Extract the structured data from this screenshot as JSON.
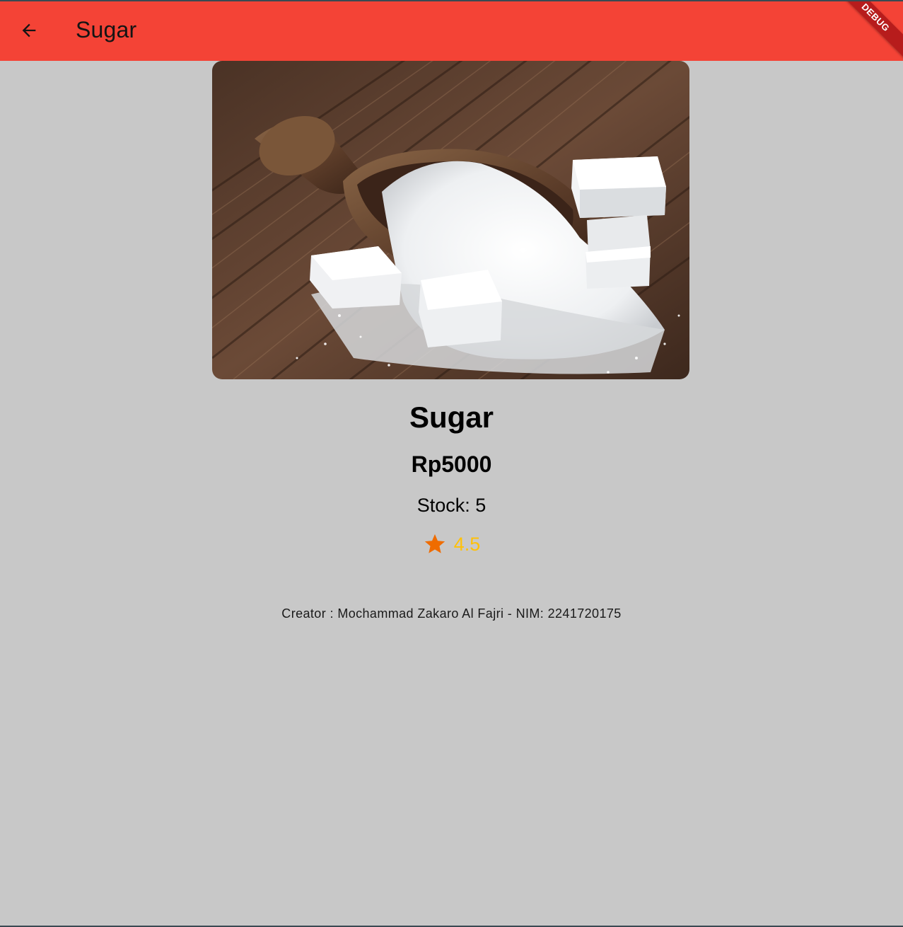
{
  "app_bar": {
    "title": "Sugar",
    "back_icon": "arrow-back-icon",
    "background_color": "#f44336",
    "debug_banner": "DEBUG"
  },
  "product": {
    "image_subject": "sugar-photo",
    "name": "Sugar",
    "price": "Rp5000",
    "stock": "Stock: 5",
    "rating_icon": "star-icon",
    "rating_icon_color": "#ef6c00",
    "rating": "4.5",
    "rating_color": "#ffc107"
  },
  "footer": {
    "creator": "Creator : Mochammad Zakaro Al Fajri - NIM: 2241720175"
  }
}
